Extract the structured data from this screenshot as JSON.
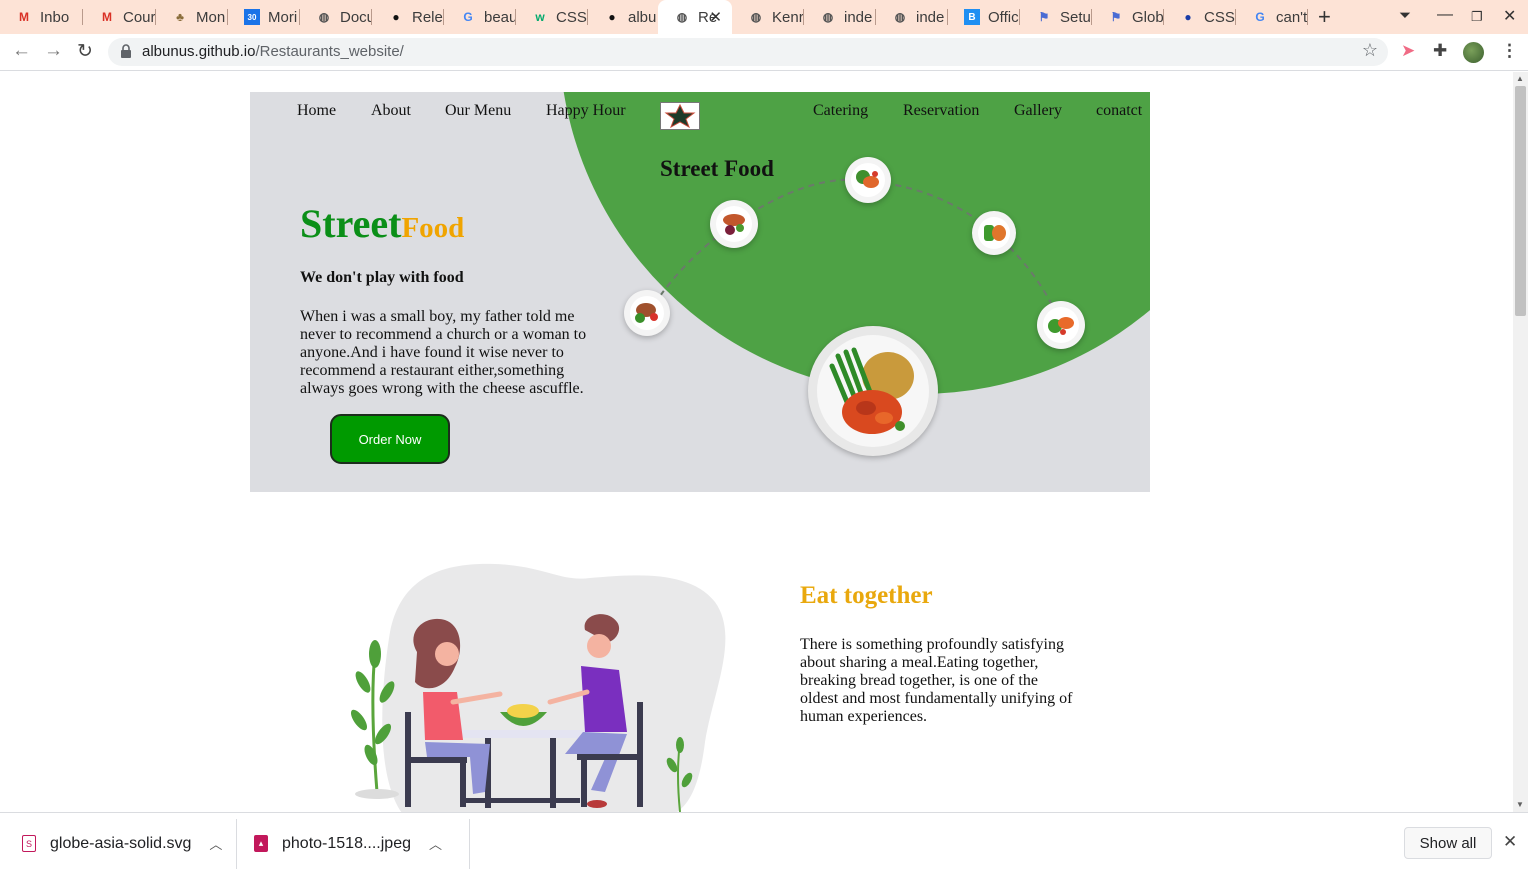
{
  "browser": {
    "tabs": [
      {
        "label": "Inbo",
        "icon": "gmail-icon",
        "color": "#d93025"
      },
      {
        "label": "Cour",
        "icon": "gmail-icon",
        "color": "#d93025"
      },
      {
        "label": "Mon",
        "icon": "tree-icon",
        "color": "#8a6d3b"
      },
      {
        "label": "Mori",
        "icon": "calendar-icon",
        "color": "#1a73e8"
      },
      {
        "label": "Docu",
        "icon": "globe-icon",
        "color": "#555555"
      },
      {
        "label": "Rele",
        "icon": "github-icon",
        "color": "#111111"
      },
      {
        "label": "beau",
        "icon": "google-icon",
        "color": "#4285f4"
      },
      {
        "label": "CSS (",
        "icon": "w3schools-icon",
        "color": "#04aa6d"
      },
      {
        "label": "albu",
        "icon": "github-icon",
        "color": "#111111"
      },
      {
        "label": "Re",
        "icon": "globe-icon",
        "color": "#555555",
        "active": true
      },
      {
        "label": "Kenr",
        "icon": "globe-icon",
        "color": "#555555"
      },
      {
        "label": "inde",
        "icon": "globe-icon",
        "color": "#555555"
      },
      {
        "label": "inde",
        "icon": "globe-icon",
        "color": "#555555"
      },
      {
        "label": "Offic",
        "icon": "bootstrap-icon",
        "color": "#1f8ff2"
      },
      {
        "label": "Setu",
        "icon": "flag-icon",
        "color": "#4a6cd4"
      },
      {
        "label": "Glob",
        "icon": "flag-icon",
        "color": "#4a6cd4"
      },
      {
        "label": "CSS (",
        "icon": "circle-icon",
        "color": "#1a3ca8"
      },
      {
        "label": "can't",
        "icon": "google-icon",
        "color": "#4285f4"
      }
    ],
    "url_host": "albunus.github.io",
    "url_path": "/Restaurants_website/"
  },
  "nav": {
    "left": [
      "Home",
      "About",
      "Our Menu",
      "Happy Hour"
    ],
    "right": [
      "Catering",
      "Reservation",
      "Gallery",
      "conatct"
    ]
  },
  "hero": {
    "title_part1": "Street",
    "title_part2": "Food",
    "tagline": "We don't play with food",
    "text": "When i was a small boy, my father told me never to recommend a church or a woman to anyone.And i have found it wise never to recommend a restaurant either,something always goes wrong with the cheese ascuffle.",
    "button": "Order Now",
    "plates_title": "Street Food"
  },
  "section2": {
    "title": "Eat together",
    "text": "There is something profoundly satisfying about sharing a meal.Eating together, breaking bread together, is one of the oldest and most fundamentally unifying of human experiences."
  },
  "downloads": {
    "items": [
      {
        "name": "globe-asia-solid.svg",
        "color": "#c2185b"
      },
      {
        "name": "photo-1518....jpeg",
        "color": "#c2185b"
      }
    ],
    "show_all": "Show all"
  },
  "colors": {
    "hero_bg": "#dcdde1",
    "hero_circle": "#4ea245",
    "title_green": "#0b8f18",
    "title_orange": "#f0a400",
    "button_green": "#009a00",
    "section_title": "#e9a80d"
  }
}
